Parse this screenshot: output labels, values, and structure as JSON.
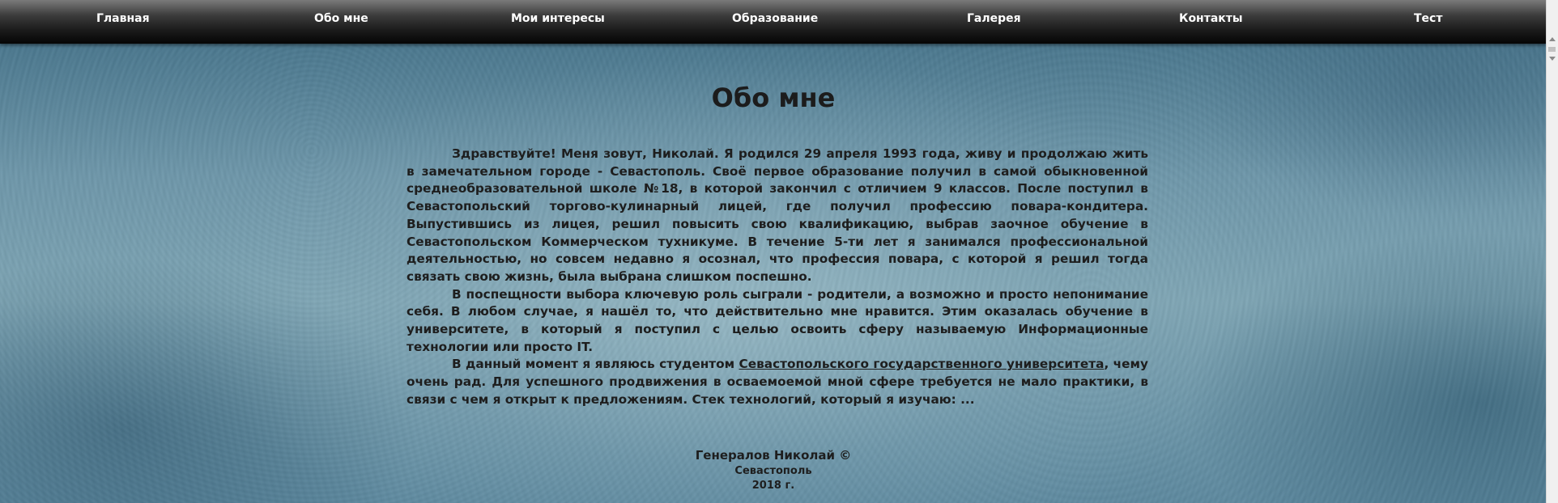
{
  "nav": {
    "items": [
      "Главная",
      "Обо мне",
      "Мои интересы",
      "Образование",
      "Галерея",
      "Контакты",
      "Тест"
    ]
  },
  "main": {
    "title": "Обо мне",
    "paragraphs": {
      "p1": "Здравствуйте! Меня зовут, Николай. Я родился 29 апреля 1993 года, живу и продолжаю жить в замечательном городе - Севастополь. Своё первое образование получил в самой обыкновенной среднеобразовательной школе №18, в которой закончил с отличием 9 классов. После поступил в Севастопольский торгово-кулинарный лицей, где получил профессию повара-кондитера. Выпустившись из лицея, решил повысить свою квалификацию, выбрав заочное обучение в Севастопольском Коммерческом тухникуме. В течение 5-ти лет я занимался профессиональной деятельностью, но совсем недавно я осознал, что профессия повара, с которой я решил тогда связать свою жизнь, была выбрана слишком поспешно.",
      "p2": "В поспещности выбора ключевую роль сыграли - родители, а возможно и просто непонимание себя. В любом случае, я нашёл то, что действительно мне нравится. Этим оказалась обучение в университете, в который я поступил с целью освоить сферу называемую Информационные технологии или просто IT.",
      "p3_before": "В данный момент я являюсь студентом ",
      "p3_link": "Севастопольского государственного университета",
      "p3_after": ", чему очень рад. Для успешного продвижения в осваемоемой мной сфере требуется не мало практики, в связи с чем я открыт к предложениям. Стек технологий, который я изучаю: ..."
    }
  },
  "footer": {
    "author": "Генералов Николай ©",
    "city": "Севастополь",
    "year": "2018 г."
  },
  "colors": {
    "navbar": "#1a1a1a",
    "text": "#1e1e1e",
    "background": "#6f98ab"
  }
}
